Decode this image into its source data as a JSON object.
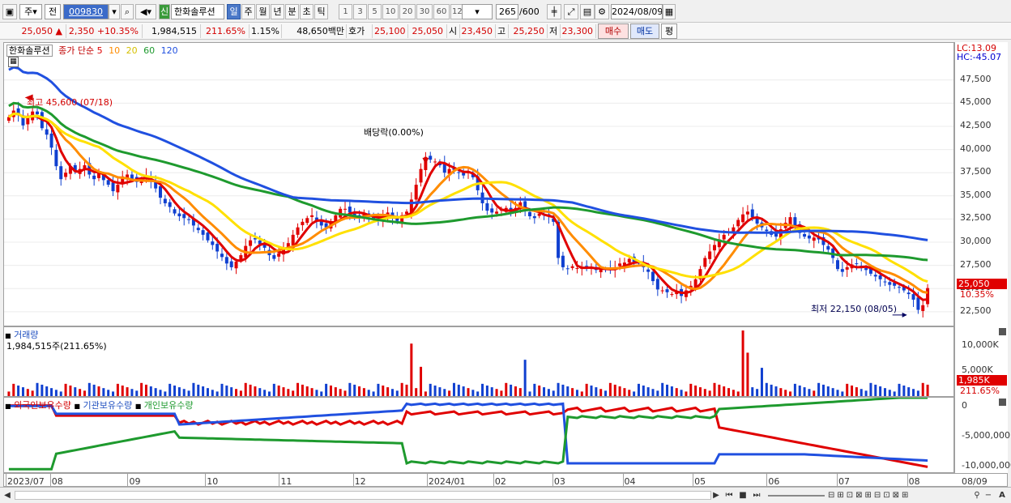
{
  "toolbar": {
    "type_label": "주",
    "all_label": "전",
    "code": "009830",
    "sin_label": "신",
    "stock_name": "한화솔루션",
    "periods": [
      "일",
      "주",
      "월",
      "년",
      "분",
      "초",
      "틱"
    ],
    "intervals": [
      "1",
      "3",
      "5",
      "10",
      "20",
      "30",
      "60",
      "120"
    ],
    "count": "265",
    "total": "/600",
    "date": "2024/08/09"
  },
  "info": {
    "price": "25,050 ▲",
    "change": "2,350 +10.35%",
    "volume": "1,984,515",
    "volume_ratio": "211.65%",
    "turnover": "1.15%",
    "amount": "48,650백만",
    "ask_label": "호가",
    "ask": "25,100",
    "bid": "25,050",
    "open_label": "시",
    "open": "23,450",
    "high_label": "고",
    "high": "25,250",
    "low_label": "저",
    "low": "23,300",
    "buy_label": "매수",
    "sell_label": "매도",
    "eval_label": "평"
  },
  "price_panel": {
    "stock_label": "한화솔루션",
    "ma_label": "종가 단순",
    "ma_periods": [
      "5",
      "10",
      "20",
      "60",
      "120"
    ],
    "lc": "LC:13.09",
    "hc": "HC:-45.07",
    "high_note": "최고 45,600 (07/18)",
    "low_note": "최저 22,150 (08/05)",
    "dividend_note": "배당락(0.00%)",
    "price_tag": "25,050",
    "pct_tag": "10.35%"
  },
  "volume_panel": {
    "title": "거래량",
    "value_text": "1,984,515주(211.65%)",
    "tag": "1,985K",
    "pct_tag": "211.65%"
  },
  "holdings_panel": {
    "legend": [
      "외국인보유수량",
      "기관보유수량",
      "개인보유수량"
    ]
  },
  "chart_data": [
    {
      "type": "candlestick",
      "title": "한화솔루션",
      "x": [
        "2023/07",
        "08",
        "09",
        "10",
        "11",
        "12",
        "2024/01",
        "02",
        "03",
        "04",
        "05",
        "06",
        "07",
        "08",
        "08/09"
      ],
      "ylim": [
        21000,
        51500
      ],
      "yticks": [
        22500,
        25000,
        27500,
        30000,
        32500,
        35000,
        37500,
        40000,
        42500,
        45000,
        47500
      ],
      "ytick_labels": [
        "22,500",
        "25,000",
        "27,500",
        "30,000",
        "32,500",
        "35,000",
        "37,500",
        "40,000",
        "42,500",
        "45,000",
        "47,500"
      ],
      "close": [
        43500,
        44200,
        43800,
        42600,
        43400,
        44100,
        43800,
        42300,
        41600,
        40200,
        38200,
        36800,
        37500,
        38200,
        37600,
        37900,
        38300,
        37300,
        36800,
        37500,
        36700,
        36200,
        35500,
        36200,
        37100,
        37300,
        36800,
        36500,
        36800,
        37200,
        36600,
        35800,
        34800,
        34200,
        33800,
        33100,
        32800,
        32600,
        32400,
        31800,
        31300,
        30800,
        30200,
        29700,
        29000,
        28400,
        27700,
        27300,
        27900,
        28600,
        29600,
        30200,
        30300,
        29800,
        29400,
        28600,
        28200,
        28800,
        29300,
        29900,
        30800,
        31600,
        32200,
        32600,
        32900,
        32300,
        31800,
        31600,
        32100,
        32900,
        33600,
        33600,
        33200,
        32800,
        32800,
        33100,
        32700,
        32500,
        32300,
        32800,
        33200,
        32600,
        32300,
        32900,
        33300,
        34600,
        36200,
        37900,
        39200,
        38900,
        38700,
        38300,
        37500,
        37900,
        37800,
        37500,
        37200,
        37600,
        37000,
        35600,
        34200,
        33400,
        33200,
        33300,
        33500,
        33700,
        33300,
        33700,
        34300,
        33500,
        32800,
        32600,
        33100,
        32900,
        32800,
        32200,
        28300,
        27300,
        27100,
        27400,
        27200,
        27200,
        27300,
        27200,
        27000,
        27100,
        27000,
        27100,
        27300,
        27700,
        27800,
        28200,
        27900,
        27700,
        27300,
        26800,
        25800,
        24900,
        24800,
        24600,
        24400,
        24700,
        24200,
        24800,
        25300,
        26000,
        27100,
        28300,
        29000,
        29700,
        30300,
        30800,
        31100,
        31600,
        32400,
        33000,
        33300,
        32700,
        32000,
        31600,
        31200,
        30800,
        30600,
        31400,
        32100,
        32700,
        31700,
        31000,
        30600,
        30400,
        30500,
        30300,
        29700,
        29200,
        28300,
        27100,
        26800,
        27300,
        27600,
        27700,
        27200,
        27000,
        26600,
        26300,
        26000,
        25700,
        25400,
        25300,
        25100,
        24800,
        24400,
        23800,
        22700,
        23200,
        25050
      ],
      "ma_series": [
        {
          "name": "5",
          "color": "#e00000"
        },
        {
          "name": "10",
          "color": "#ff8c00"
        },
        {
          "name": "20",
          "color": "#ffe000"
        },
        {
          "name": "60",
          "color": "#1e9a2e"
        },
        {
          "name": "120",
          "color": "#2050e0"
        }
      ],
      "annotations": [
        {
          "text": "최고 45,600 (07/18)",
          "value": 45600
        },
        {
          "text": "최저 22,150 (08/05)",
          "value": 22150
        },
        {
          "text": "배당락(0.00%)",
          "value": 38400
        }
      ]
    },
    {
      "type": "bar",
      "title": "거래량",
      "ylim": [
        0,
        13000000
      ],
      "yticks": [
        5000000,
        10000000
      ],
      "ytick_labels": [
        "5,000K",
        "10,000K"
      ],
      "spikes": [
        {
          "index": 85,
          "value": 10400000
        },
        {
          "index": 87,
          "value": 5800000
        },
        {
          "index": 109,
          "value": 7200000
        },
        {
          "index": 155,
          "value": 13000000
        },
        {
          "index": 156,
          "value": 8600000
        },
        {
          "index": 159,
          "value": 5600000
        }
      ]
    },
    {
      "type": "line",
      "title": "외국인보유수량 / 기관보유수량 / 개인보유수량",
      "ylim": [
        -11000000,
        1500000
      ],
      "yticks": [
        0,
        -5000000,
        -10000000
      ],
      "ytick_labels": [
        "0",
        "-5,000,000",
        "-10,000,000"
      ],
      "series": [
        {
          "name": "외국인보유수량",
          "color": "#e00000"
        },
        {
          "name": "기관보유수량",
          "color": "#2050e0"
        },
        {
          "name": "개인보유수량",
          "color": "#1e9a2e"
        }
      ]
    }
  ]
}
